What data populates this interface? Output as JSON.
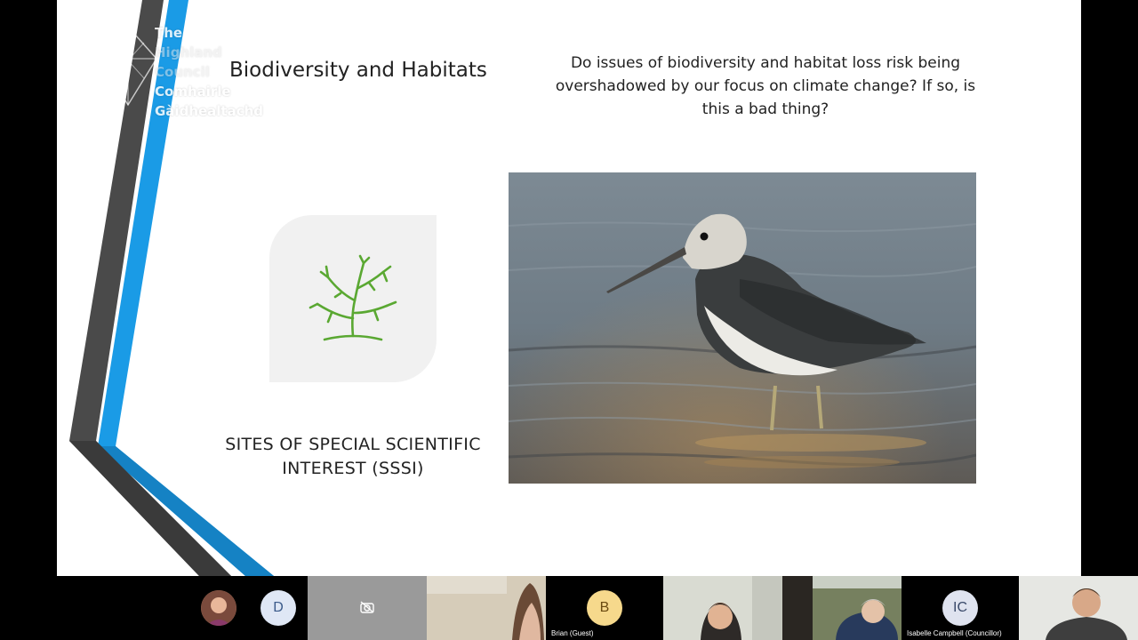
{
  "slide": {
    "logo_lines": [
      "The",
      "Highland",
      "Council",
      "Comhairle",
      "Gàidhealtachd"
    ],
    "title": "Biodiversity and Habitats",
    "question": "Do issues of biodiversity and habitat loss risk being overshadowed by our focus on climate change? If so, is this a bad thing?",
    "tile_label_line1": "SITES OF SPECIAL SCIENTIFIC",
    "tile_label_line2": "INTEREST (SSSI)",
    "icon": "coral-branch-icon",
    "photo_subject": "",
    "colors": {
      "stripe_blue": "#1a9be6",
      "stripe_grey": "#4a4a4a",
      "icon_green": "#5aa832",
      "tile_bg": "#f1f1f1"
    }
  },
  "participants": [
    {
      "id": "p1",
      "initial": "",
      "name": "",
      "type": "photo-avatar"
    },
    {
      "id": "p2",
      "initial": "D",
      "name": "",
      "type": "initial"
    },
    {
      "id": "p3",
      "initial": "",
      "name": "",
      "type": "camera-off"
    },
    {
      "id": "p4",
      "initial": "",
      "name": "",
      "type": "video"
    },
    {
      "id": "p5",
      "initial": "B",
      "name": "Brian (Guest)",
      "type": "initial"
    },
    {
      "id": "p6",
      "initial": "",
      "name": "",
      "type": "video"
    },
    {
      "id": "p7",
      "initial": "",
      "name": "",
      "type": "video"
    },
    {
      "id": "p8",
      "initial": "IC",
      "name": "Isabelle Campbell (Councillor)",
      "type": "initial"
    },
    {
      "id": "p9",
      "initial": "",
      "name": "",
      "type": "video"
    }
  ]
}
